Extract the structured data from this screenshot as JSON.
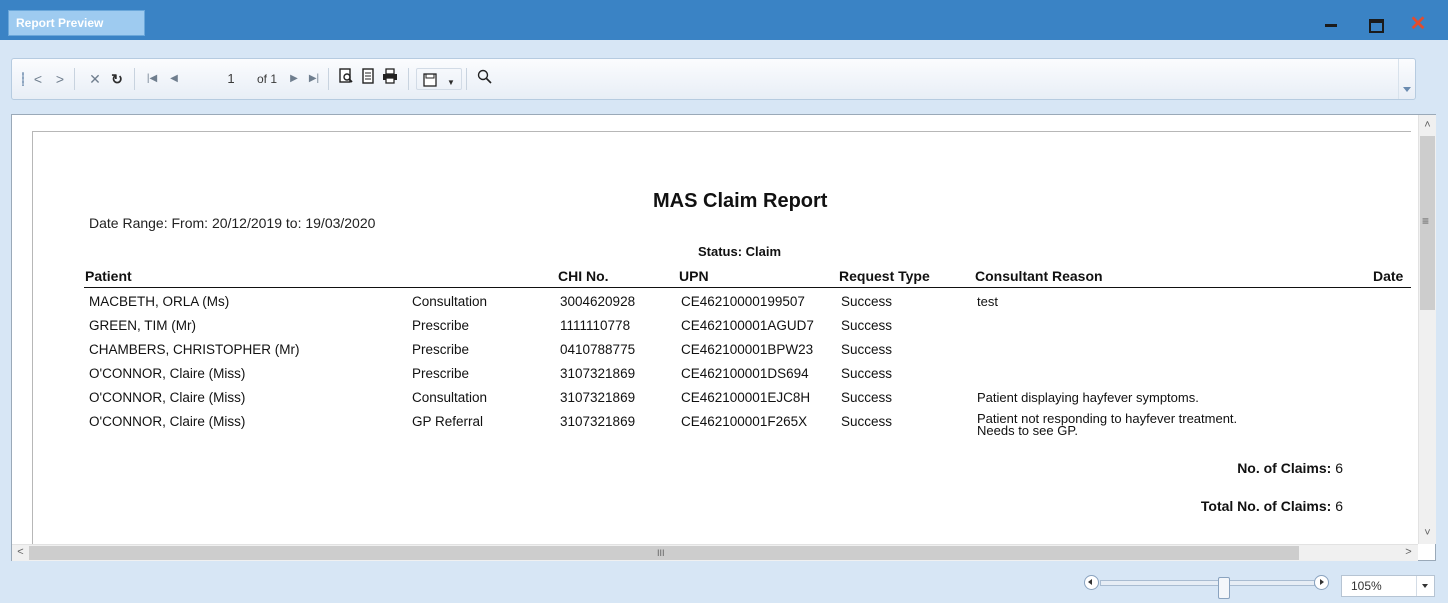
{
  "window": {
    "title": "Report Preview"
  },
  "toolbar": {
    "back_icon": "chevron-left-icon",
    "forward_icon": "chevron-right-icon",
    "page_current": "1",
    "page_of": "of 1"
  },
  "report": {
    "title": "MAS Claim Report",
    "date_range": "Date Range: From: 20/12/2019 to: 19/03/2020",
    "status": "Status: Claim",
    "columns": [
      "Patient",
      "CHI No.",
      "UPN",
      "Request Type",
      "Consultant Reason",
      "Date"
    ],
    "rows": [
      {
        "patient": "MACBETH, ORLA (Ms)",
        "service": "Consultation",
        "chi": "3004620928",
        "upn": "CE46210000199507",
        "request": "Success",
        "reason": "test"
      },
      {
        "patient": "GREEN, TIM (Mr)",
        "service": "Prescribe",
        "chi": "1111110778",
        "upn": "CE462100001AGUD7",
        "request": "Success",
        "reason": ""
      },
      {
        "patient": "CHAMBERS, CHRISTOPHER (Mr)",
        "service": "Prescribe",
        "chi": "0410788775",
        "upn": "CE462100001BPW23",
        "request": "Success",
        "reason": ""
      },
      {
        "patient": "O'CONNOR, Claire (Miss)",
        "service": "Prescribe",
        "chi": "3107321869",
        "upn": "CE462100001DS694",
        "request": "Success",
        "reason": ""
      },
      {
        "patient": "O'CONNOR, Claire (Miss)",
        "service": "Consultation",
        "chi": "3107321869",
        "upn": "CE462100001EJC8H",
        "request": "Success",
        "reason": "Patient displaying hayfever symptoms."
      },
      {
        "patient": "O'CONNOR, Claire (Miss)",
        "service": "GP Referral",
        "chi": "3107321869",
        "upn": "CE462100001F265X",
        "request": "Success",
        "reason": "Patient not responding to hayfever treatment.\nNeeds to see GP."
      }
    ],
    "claims_label": "No. of Claims:",
    "claims_value": "6",
    "total_label": "Total No. of Claims:",
    "total_value": "6"
  },
  "zoom": {
    "level": "105%"
  },
  "colors": {
    "titlebar": "#3a83c5",
    "close": "#e24c2e"
  }
}
